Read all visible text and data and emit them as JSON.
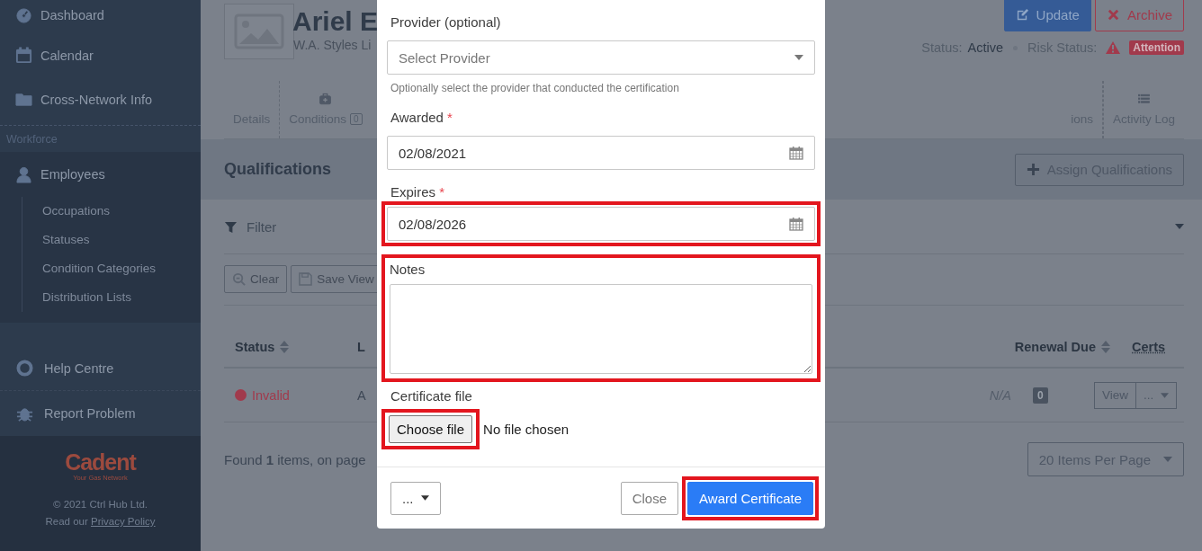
{
  "sidebar": {
    "items": [
      {
        "label": "Dashboard"
      },
      {
        "label": "Calendar"
      },
      {
        "label": "Cross-Network Info"
      }
    ],
    "section": "Workforce",
    "group": {
      "label": "Employees",
      "children": [
        {
          "label": "Occupations"
        },
        {
          "label": "Statuses"
        },
        {
          "label": "Condition Categories"
        },
        {
          "label": "Distribution Lists"
        }
      ]
    },
    "bottom_items": [
      {
        "label": "Help Centre"
      },
      {
        "label": "Report Problem"
      }
    ],
    "footer": {
      "logo": "Cadent",
      "tagline": "Your Gas Network",
      "copyright": "© 2021 Ctrl Hub Ltd.",
      "privacy_prefix": "Read our ",
      "privacy_link": "Privacy Policy"
    }
  },
  "header": {
    "name": "Ariel E",
    "subtitle": "W.A. Styles Li",
    "buttons": [
      {
        "label": "Update",
        "kind": "primary"
      },
      {
        "label": "Archive",
        "kind": "danger"
      }
    ],
    "status_label": "Status:",
    "status_value": "Active",
    "risk_label": "Risk Status:",
    "risk_badge": "Attention"
  },
  "tabs_left": [
    {
      "label": "Details"
    },
    {
      "label": "Conditions",
      "count": "0"
    }
  ],
  "tabs_right": [
    {
      "label": "ions"
    },
    {
      "label": "Activity Log"
    }
  ],
  "section": {
    "title": "Qualifications",
    "button": "Assign Qualifications"
  },
  "filter": {
    "label": "Filter",
    "buttons": [
      "Clear",
      "Save View"
    ]
  },
  "table": {
    "columns": [
      {
        "label": "Status",
        "sortable": true
      },
      {
        "label": "L",
        "sortable": false
      },
      {
        "label": "Renewal Due",
        "sortable": true
      },
      {
        "label": "Certs",
        "sortable": false
      }
    ],
    "rows": [
      {
        "status": "Invalid",
        "color": "#a13a4c",
        "column_2": "A",
        "renewal_due": "N/A",
        "certs": "0",
        "view": "View",
        "more": "..."
      }
    ]
  },
  "footer": {
    "found": "Found **1** items, on page",
    "per_page": "20 Items Per Page"
  },
  "modal": {
    "fields": [
      {
        "kind": "select",
        "label": "Provider (optional)",
        "placeholder": "Select Provider",
        "help": "Optionally select the provider that conducted the certification",
        "highlighted": false
      },
      {
        "kind": "date",
        "label": "Awarded",
        "required_mark": "*",
        "value": "02/08/2021",
        "highlighted": false
      },
      {
        "kind": "date",
        "label": "Expires",
        "required_mark": "*",
        "value": "02/08/2026",
        "highlighted": true
      },
      {
        "kind": "textarea",
        "label": "Notes",
        "highlighted": true
      },
      {
        "kind": "file",
        "label": "Certificate file",
        "button": "Choose file",
        "status": "No file chosen",
        "highlighted": true
      }
    ],
    "footer": {
      "menu": "...",
      "close": "Close",
      "submit": "Award Certificate",
      "submit_highlighted": true
    }
  }
}
